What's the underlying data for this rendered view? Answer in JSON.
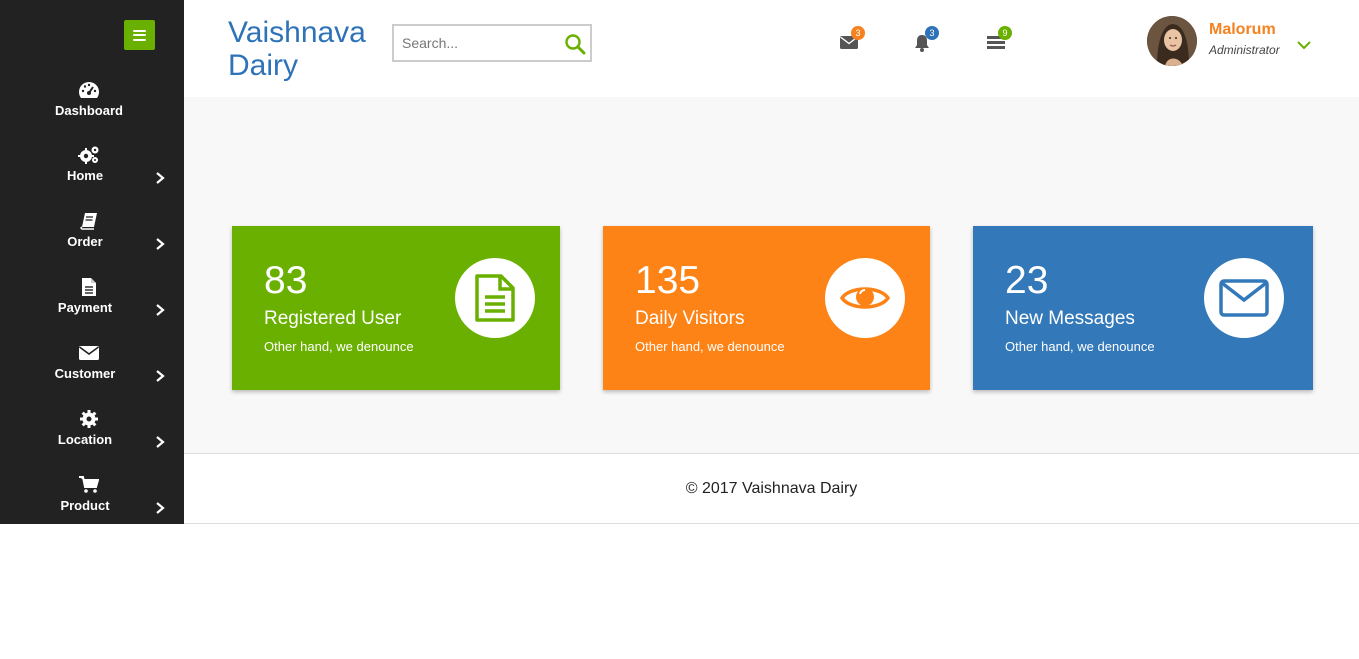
{
  "brand": {
    "line1": "Vaishnava",
    "line2": "Dairy"
  },
  "search": {
    "placeholder": "Search...",
    "value": ""
  },
  "header_icons": [
    {
      "icon": "envelope-icon",
      "badge": "3",
      "badge_color": "#f6821f"
    },
    {
      "icon": "bell-icon",
      "badge": "3",
      "badge_color": "#2e73b8"
    },
    {
      "icon": "tasks-icon",
      "badge": "9",
      "badge_color": "#6ab000"
    }
  ],
  "user": {
    "name": "Malorum",
    "role": "Administrator"
  },
  "sidebar": {
    "items": [
      {
        "label": "Dashboard",
        "icon": "dashboard-gauge-icon",
        "has_submenu": false
      },
      {
        "label": "Home",
        "icon": "gears-icon",
        "has_submenu": true
      },
      {
        "label": "Order",
        "icon": "book-icon",
        "has_submenu": true
      },
      {
        "label": "Payment",
        "icon": "file-text-icon",
        "has_submenu": true
      },
      {
        "label": "Customer",
        "icon": "envelope-icon",
        "has_submenu": true
      },
      {
        "label": "Location",
        "icon": "gear-icon",
        "has_submenu": true
      },
      {
        "label": "Product",
        "icon": "cart-icon",
        "has_submenu": true
      }
    ]
  },
  "cards": [
    {
      "count": "83",
      "title": "Registered User",
      "subtitle": "Other hand, we denounce",
      "color": "#6ab000",
      "icon": "document-icon"
    },
    {
      "count": "135",
      "title": "Daily Visitors",
      "subtitle": "Other hand, we denounce",
      "color": "#fd8316",
      "icon": "eye-icon"
    },
    {
      "count": "23",
      "title": "New Messages",
      "subtitle": "Other hand, we denounce",
      "color": "#3378b8",
      "icon": "envelope-icon"
    }
  ],
  "footer": {
    "text": "© 2017 Vaishnava Dairy"
  },
  "colors": {
    "sidebar_bg": "#222222",
    "accent_green": "#6ab000",
    "accent_orange": "#f6821f",
    "brand_blue": "#2e73b8"
  }
}
